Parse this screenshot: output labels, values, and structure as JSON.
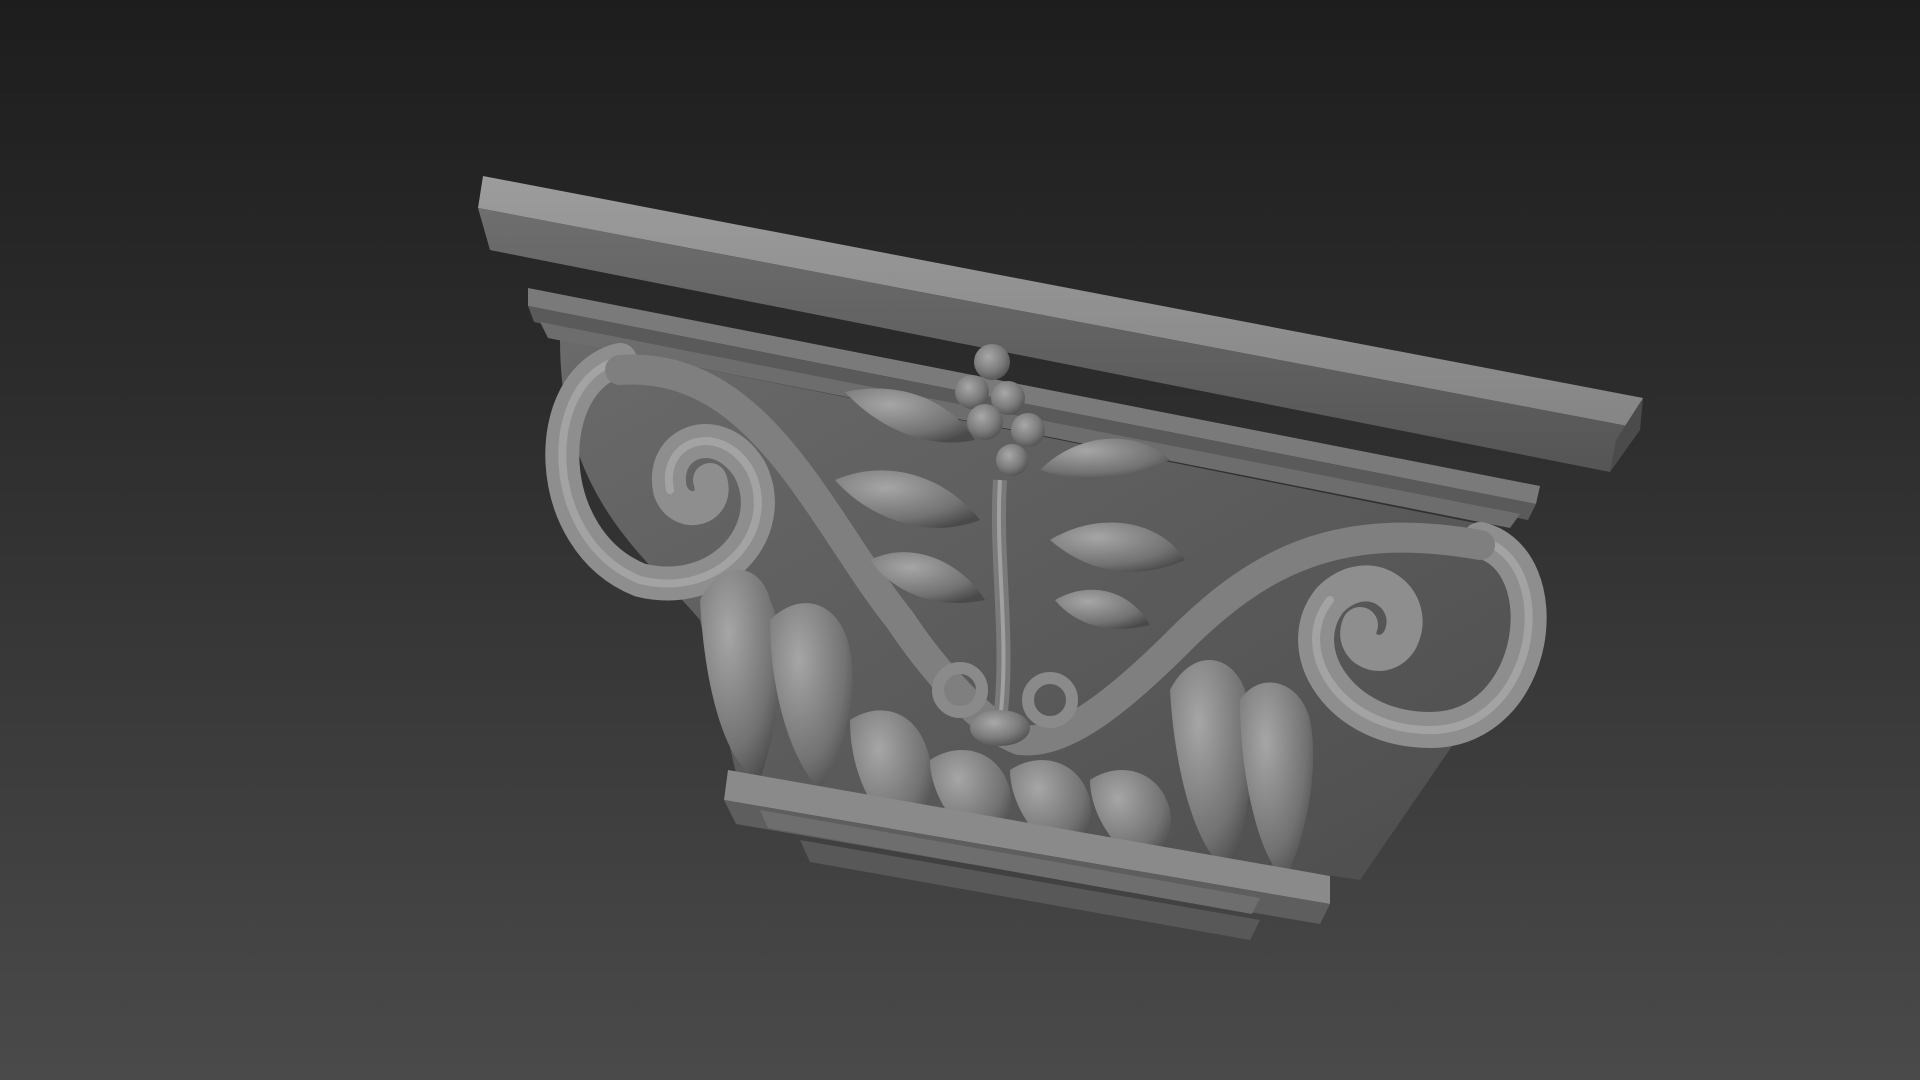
{
  "scene": {
    "background_top": "#1d1d1d",
    "background_bottom": "#4a4a4a",
    "model_color": "#8a8a8a",
    "subject": "pilaster-capital-model"
  }
}
